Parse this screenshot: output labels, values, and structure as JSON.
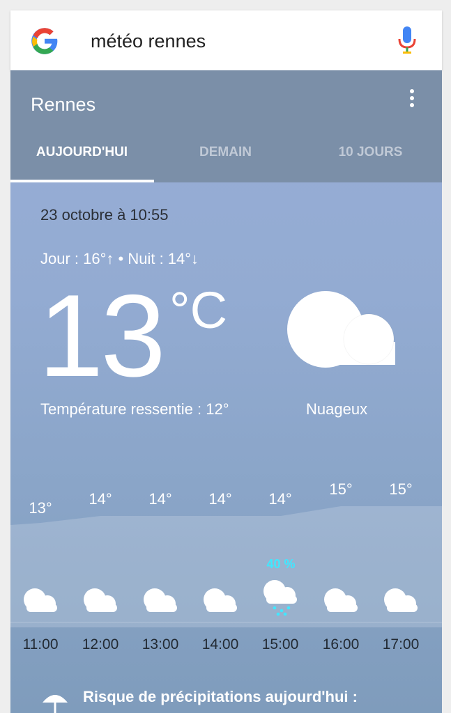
{
  "search": {
    "query": "météo rennes",
    "logo_icon": "google-g-icon",
    "mic_icon": "microphone-icon"
  },
  "card": {
    "city": "Rennes",
    "menu_icon": "more-vertical-icon",
    "tabs": [
      {
        "label": "AUJOURD'HUI",
        "active": true
      },
      {
        "label": "DEMAIN",
        "active": false
      },
      {
        "label": "10 JOURS",
        "active": false
      }
    ]
  },
  "current": {
    "datetime": "23 octobre à 10:55",
    "day_night": "Jour : 16°↑ • Nuit : 14°↓",
    "temperature": "13",
    "unit": "°C",
    "feels_like": "Température ressentie : 12°",
    "condition": "Nuageux",
    "condition_icon": "cloud-icon"
  },
  "hourly": [
    {
      "time": "11:00",
      "temp": "13°",
      "icon": "cloud-icon",
      "precip": ""
    },
    {
      "time": "12:00",
      "temp": "14°",
      "icon": "cloud-icon",
      "precip": ""
    },
    {
      "time": "13:00",
      "temp": "14°",
      "icon": "cloud-icon",
      "precip": ""
    },
    {
      "time": "14:00",
      "temp": "14°",
      "icon": "cloud-icon",
      "precip": ""
    },
    {
      "time": "15:00",
      "temp": "14°",
      "icon": "rain-cloud-icon",
      "precip": "40 %"
    },
    {
      "time": "16:00",
      "temp": "15°",
      "icon": "cloud-icon",
      "precip": ""
    },
    {
      "time": "17:00",
      "temp": "15°",
      "icon": "cloud-icon",
      "precip": ""
    }
  ],
  "precip_risk": {
    "icon": "umbrella-icon",
    "text": "Risque de précipitations aujourd'hui :"
  },
  "colors": {
    "header": "#7b8fa8",
    "sky_top": "#98aed6",
    "precip_accent": "#40e8ff"
  }
}
